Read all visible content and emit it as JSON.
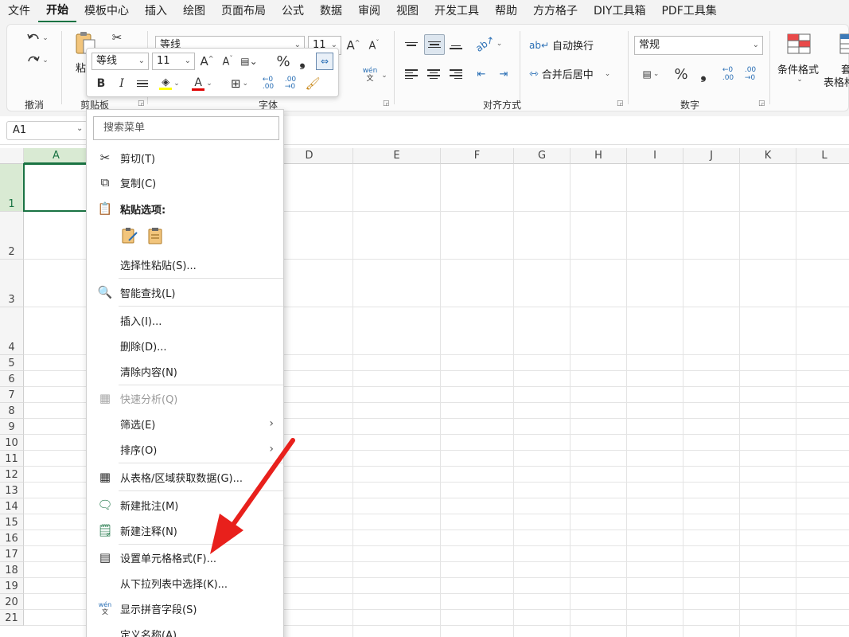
{
  "menubar": {
    "tabs": [
      "文件",
      "开始",
      "模板中心",
      "插入",
      "绘图",
      "页面布局",
      "公式",
      "数据",
      "审阅",
      "视图",
      "开发工具",
      "帮助",
      "方方格子",
      "DIY工具箱",
      "PDF工具集"
    ],
    "active": "开始"
  },
  "ribbon": {
    "groups": {
      "undo": "撤消",
      "clipboard": "剪贴板",
      "font": "字体",
      "alignment": "对齐方式",
      "number": "数字"
    },
    "clipboard_paste_label": "粘",
    "font_name": "等线",
    "font_size": "11",
    "wrap_text": "自动换行",
    "merge_center": "合并后居中",
    "number_format": "常规",
    "conditional_format": "条件格式",
    "table_format_1": "套",
    "table_format_2": "表格格",
    "phonetic_top": "wén",
    "phonetic_bottom": "文"
  },
  "formula_bar": {
    "name_box": "A1"
  },
  "grid": {
    "columns": [
      "A",
      "B",
      "C",
      "D",
      "E",
      "F",
      "G",
      "H",
      "I",
      "J",
      "K",
      "L"
    ],
    "rows": [
      "1",
      "2",
      "3",
      "4",
      "5",
      "6",
      "7",
      "8",
      "9",
      "10",
      "11",
      "12",
      "13",
      "14",
      "15",
      "16",
      "17",
      "18",
      "19",
      "20",
      "21"
    ],
    "selected_cell": "A1"
  },
  "mini_toolbar": {
    "font_name": "等线",
    "font_size": "11",
    "percent": "%",
    "comma": "❟",
    "bold": "B",
    "italic": "I",
    "font_color_letter": "A",
    "font_color": "#e00000",
    "fill_color": "#ffff00"
  },
  "context_menu": {
    "search_placeholder": "搜索菜单",
    "paste_options_label": "粘贴选项:",
    "items": {
      "cut": "剪切(T)",
      "copy": "复制(C)",
      "paste_special": "选择性粘贴(S)...",
      "smart_lookup": "智能查找(L)",
      "insert": "插入(I)...",
      "delete": "删除(D)...",
      "clear_contents": "清除内容(N)",
      "quick_analysis": "快速分析(Q)",
      "filter": "筛选(E)",
      "sort": "排序(O)",
      "get_data": "从表格/区域获取数据(G)...",
      "new_comment": "新建批注(M)",
      "new_note": "新建注释(N)",
      "format_cells": "设置单元格格式(F)...",
      "pick_from_list": "从下拉列表中选择(K)...",
      "show_phonetic": "显示拼音字段(S)",
      "define_name": "定义名称(A)..."
    }
  },
  "annotation": {
    "arrow_color": "#e8201c",
    "target": "format_cells"
  }
}
